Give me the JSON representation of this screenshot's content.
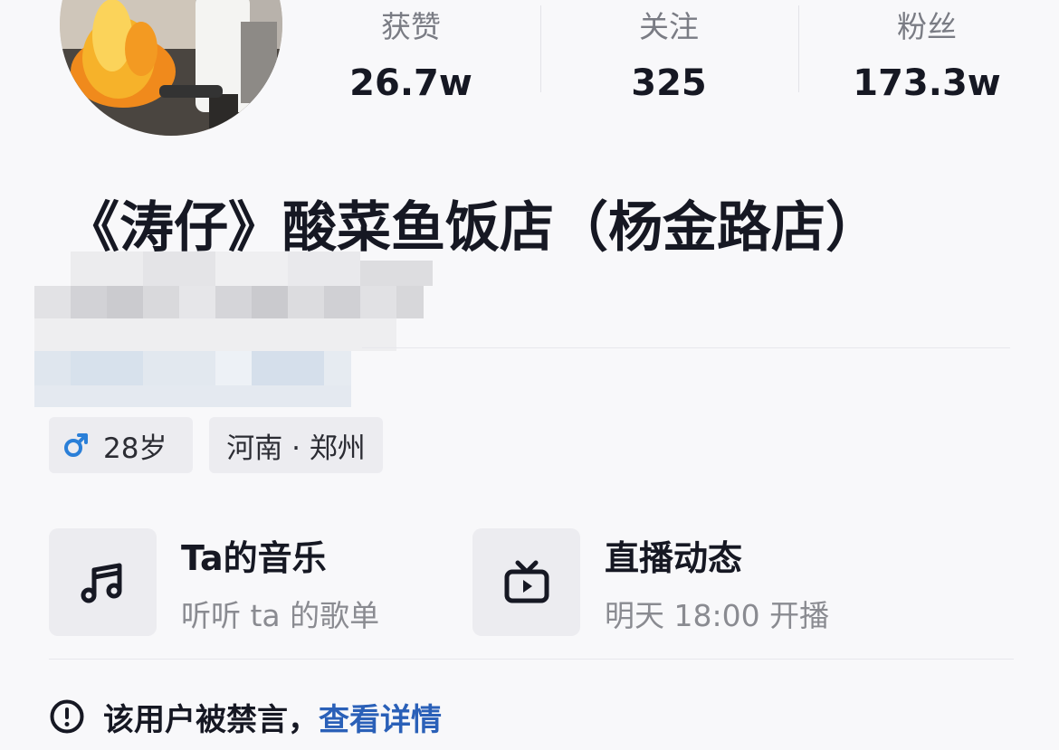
{
  "stats": [
    {
      "label": "获赞",
      "value": "26.7w"
    },
    {
      "label": "关注",
      "value": "325"
    },
    {
      "label": "粉丝",
      "value": "173.3w"
    }
  ],
  "profile": {
    "name": "《涛仔》酸菜鱼饭店（杨金路店）",
    "gender_symbol": "♂",
    "age": "28岁",
    "location": "河南 · 郑州"
  },
  "cards": {
    "music": {
      "title": "Ta的音乐",
      "subtitle": "听听 ta 的歌单",
      "icon": "music-note-icon"
    },
    "live": {
      "title": "直播动态",
      "subtitle": "明天 18:00 开播",
      "icon": "tv-icon"
    }
  },
  "notice": {
    "text": "该用户被禁言，",
    "link": "查看详情",
    "icon": "alert-circle-icon"
  },
  "colors": {
    "link": "#2a60b8",
    "gender": "#2a7fd8",
    "background": "#f8f8fa"
  }
}
